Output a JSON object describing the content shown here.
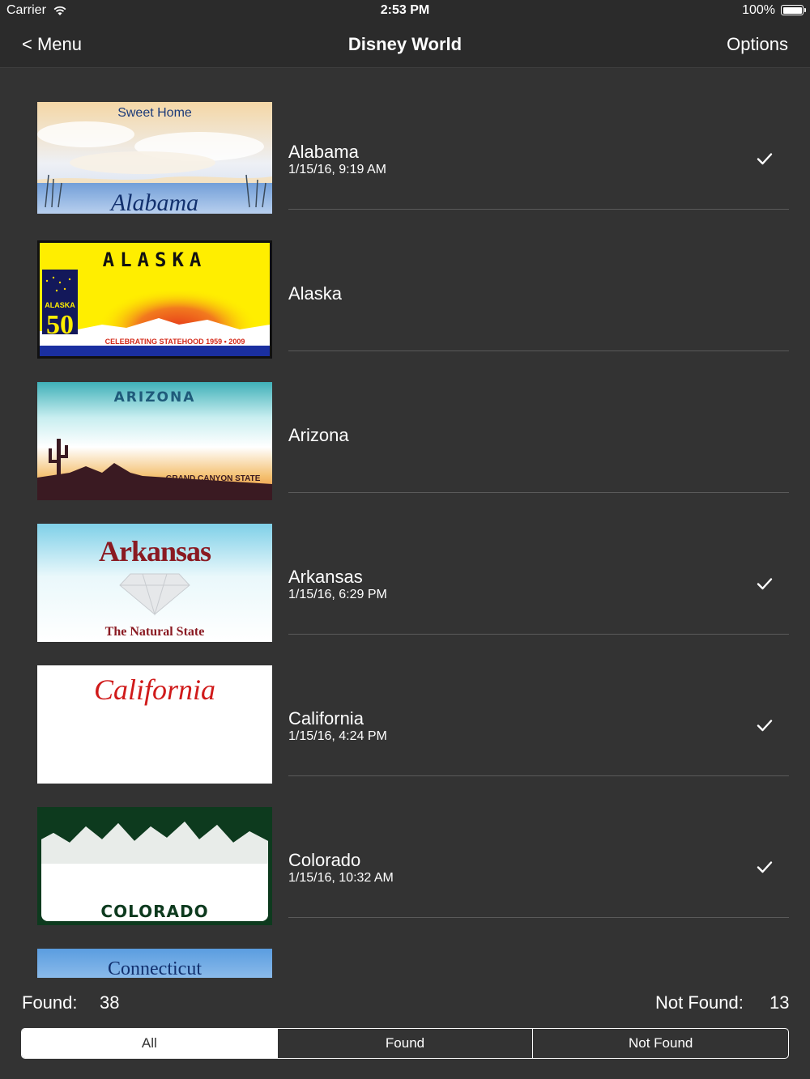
{
  "status_bar": {
    "carrier": "Carrier",
    "time": "2:53 PM",
    "battery": "100%"
  },
  "nav": {
    "back_label": "< Menu",
    "title": "Disney World",
    "options_label": "Options"
  },
  "plates": [
    {
      "state": "Alabama",
      "date": "1/15/16, 9:19 AM",
      "found": true,
      "plate_text": {
        "top": "Sweet Home",
        "bottom": "Alabama"
      }
    },
    {
      "state": "Alaska",
      "date": "",
      "found": false,
      "plate_text": {
        "top": "ALASKA",
        "badge": "ALASKA",
        "badge_num": "50",
        "bottom": "CELEBRATING STATEHOOD 1959 • 2009"
      }
    },
    {
      "state": "Arizona",
      "date": "",
      "found": false,
      "plate_text": {
        "top": "ARIZONA",
        "bottom": "GRAND CANYON STATE"
      }
    },
    {
      "state": "Arkansas",
      "date": "1/15/16, 6:29 PM",
      "found": true,
      "plate_text": {
        "top": "Arkansas",
        "bottom": "The Natural State"
      }
    },
    {
      "state": "California",
      "date": "1/15/16, 4:24 PM",
      "found": true,
      "plate_text": {
        "top": "California"
      }
    },
    {
      "state": "Colorado",
      "date": "1/15/16, 10:32 AM",
      "found": true,
      "plate_text": {
        "bottom": "COLORADO"
      }
    },
    {
      "state": "",
      "date": "",
      "found": false,
      "plate_text": {
        "top": "Connecticut"
      }
    }
  ],
  "footer": {
    "found_label": "Found:",
    "found_count": "38",
    "not_found_label": "Not Found:",
    "not_found_count": "13"
  },
  "filter": {
    "options": [
      "All",
      "Found",
      "Not Found"
    ],
    "selected": "All"
  },
  "colors": {
    "background": "#333333",
    "bar": "#2b2b2b",
    "divider": "#5a5a5a",
    "text": "#ffffff"
  }
}
